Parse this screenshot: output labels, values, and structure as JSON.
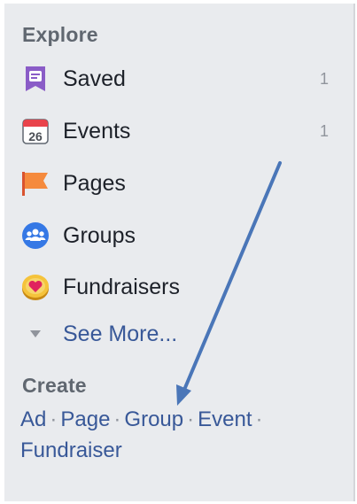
{
  "explore": {
    "title": "Explore",
    "items": [
      {
        "label": "Saved",
        "count": "1",
        "icon": "saved-bookmark-icon"
      },
      {
        "label": "Events",
        "count": "1",
        "icon": "calendar-icon",
        "icon_text": "26"
      },
      {
        "label": "Pages",
        "count": "",
        "icon": "flag-icon"
      },
      {
        "label": "Groups",
        "count": "",
        "icon": "groups-icon"
      },
      {
        "label": "Fundraisers",
        "count": "",
        "icon": "fundraiser-heart-coin-icon"
      }
    ],
    "see_more": {
      "label": "See More...",
      "icon": "caret-down-icon"
    }
  },
  "create": {
    "title": "Create",
    "links": [
      "Ad",
      "Page",
      "Group",
      "Event",
      "Fundraiser"
    ],
    "separator": "·"
  },
  "colors": {
    "panel_bg": "#e9ebee",
    "link": "#385898",
    "annotation_arrow": "#4a76b8"
  }
}
